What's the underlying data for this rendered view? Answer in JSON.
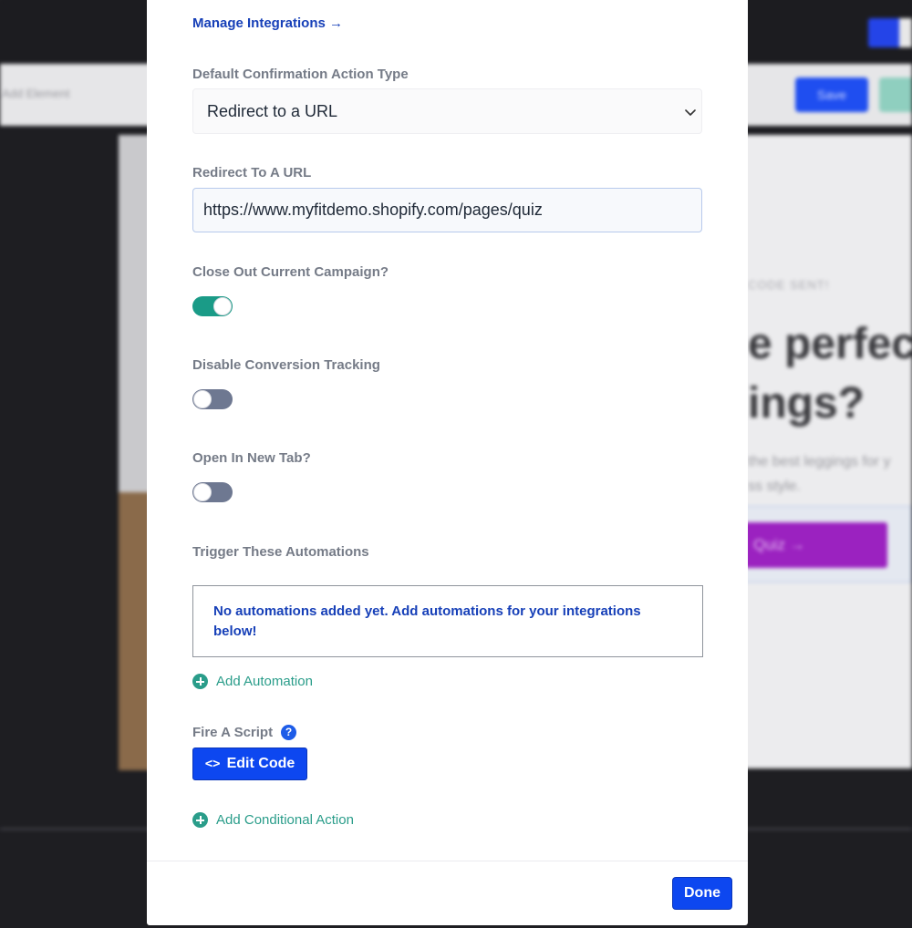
{
  "background": {
    "toolbar_left": "Add Element",
    "save_label": "Save",
    "canvas_small_text": "CODE SENT!",
    "canvas_heading_1": "e perfec",
    "canvas_heading_2": "ings?",
    "canvas_sub_1": "the best leggings for y",
    "canvas_sub_2": "ss style.",
    "canvas_button": "Quiz →"
  },
  "modal": {
    "manage_integrations": "Manage Integrations →",
    "confirmation_type": {
      "label": "Default Confirmation Action Type",
      "selected": "Redirect to a URL"
    },
    "redirect_url": {
      "label": "Redirect To A URL",
      "value": "https://www.myfitdemo.shopify.com/pages/quiz"
    },
    "close_campaign": {
      "label": "Close Out Current Campaign?",
      "on": true
    },
    "disable_tracking": {
      "label": "Disable Conversion Tracking",
      "on": false
    },
    "new_tab": {
      "label": "Open In New Tab?",
      "on": false
    },
    "automations": {
      "label": "Trigger These Automations",
      "empty_text": "No automations added yet. Add automations for your integrations below!",
      "add_label": "Add Automation"
    },
    "script": {
      "label": "Fire A Script",
      "help": "?",
      "edit_label": "Edit Code"
    },
    "add_conditional": "Add Conditional Action",
    "done_label": "Done"
  },
  "colors": {
    "primary": "#0d47f0",
    "link": "#1740b8",
    "teal": "#1a9b87",
    "toggle_off": "#6e7891"
  }
}
